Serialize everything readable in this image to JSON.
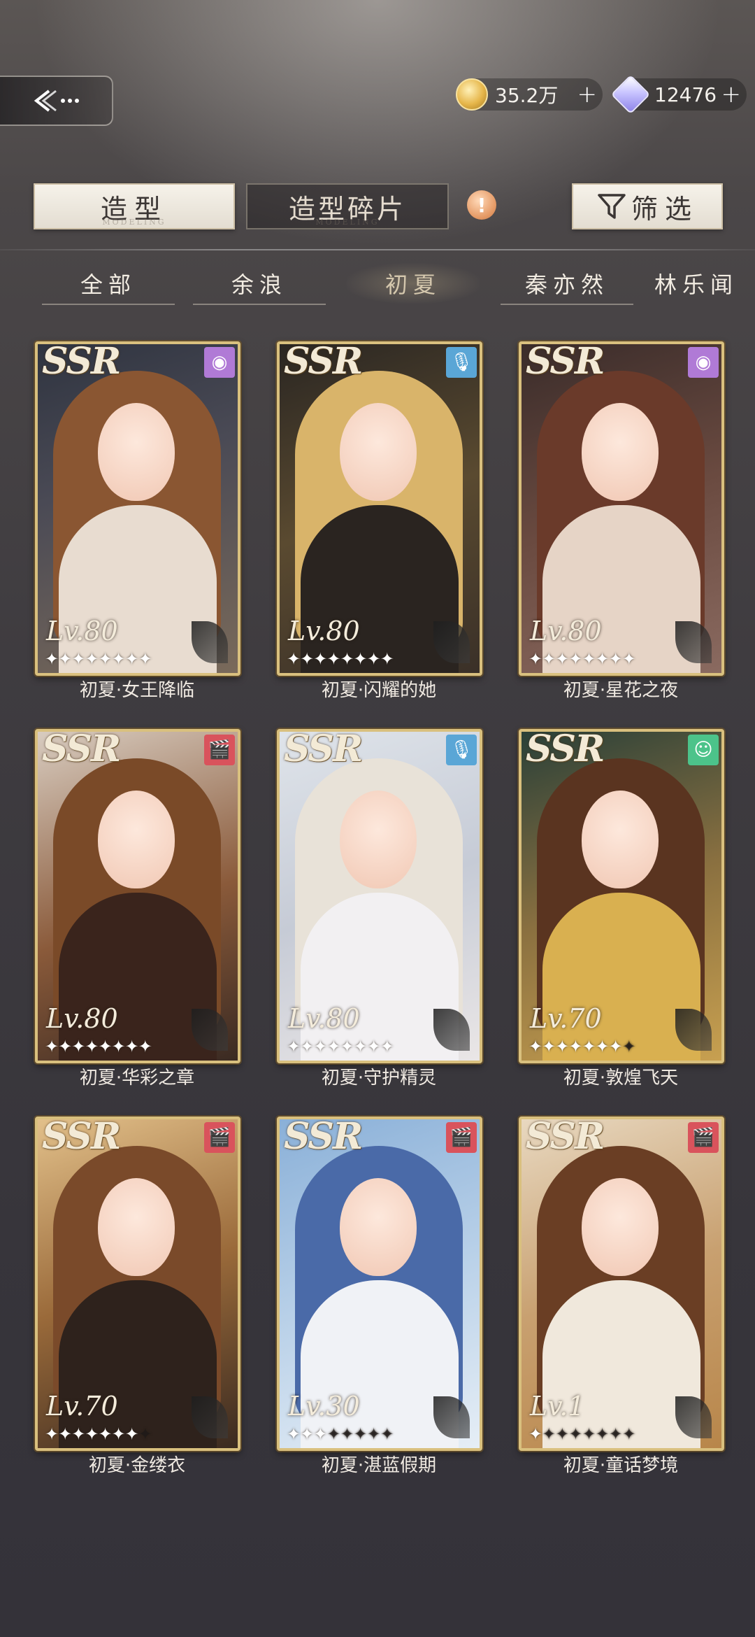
{
  "header": {
    "coins": {
      "value": "35.2万",
      "plus": "+"
    },
    "gems": {
      "value": "12476",
      "plus": "+"
    }
  },
  "tabs": {
    "outfit": "造型",
    "fragments": "造型碎片",
    "fragments_sub": "MODELING",
    "outfit_sub": "MODELING",
    "alert": "!",
    "filter": "筛选"
  },
  "character_tabs": [
    "全部",
    "余浪",
    "初夏",
    "秦亦然",
    "林乐闻"
  ],
  "cards": [
    {
      "rarity": "SSR",
      "level": "Lv.80",
      "stars": 8,
      "max_stars": 8,
      "badge": "camera",
      "name": "初夏·女王降临"
    },
    {
      "rarity": "SSR",
      "level": "Lv.80",
      "stars": 8,
      "max_stars": 8,
      "badge": "mic",
      "name": "初夏·闪耀的她"
    },
    {
      "rarity": "SSR",
      "level": "Lv.80",
      "stars": 8,
      "max_stars": 8,
      "badge": "camera",
      "name": "初夏·星花之夜"
    },
    {
      "rarity": "SSR",
      "level": "Lv.80",
      "stars": 8,
      "max_stars": 8,
      "badge": "clapper",
      "name": "初夏·华彩之章"
    },
    {
      "rarity": "SSR",
      "level": "Lv.80",
      "stars": 8,
      "max_stars": 8,
      "badge": "mic",
      "name": "初夏·守护精灵"
    },
    {
      "rarity": "SSR",
      "level": "Lv.70",
      "stars": 7,
      "max_stars": 8,
      "badge": "smile",
      "name": "初夏·敦煌飞天"
    },
    {
      "rarity": "SSR",
      "level": "Lv.70",
      "stars": 7,
      "max_stars": 8,
      "badge": "clapper",
      "name": "初夏·金缕衣"
    },
    {
      "rarity": "SSR",
      "level": "Lv.30",
      "stars": 3,
      "max_stars": 8,
      "badge": "clapper",
      "name": "初夏·湛蓝假期"
    },
    {
      "rarity": "SSR",
      "level": "Lv.1",
      "stars": 1,
      "max_stars": 8,
      "badge": "clapper",
      "name": "初夏·童话梦境"
    }
  ],
  "colors": {
    "badge_camera": "#b07ad6",
    "badge_mic": "#5aa6d6",
    "badge_clapper": "#d9535c",
    "badge_smile": "#4cc38a",
    "card_border": "#d9c07e"
  }
}
